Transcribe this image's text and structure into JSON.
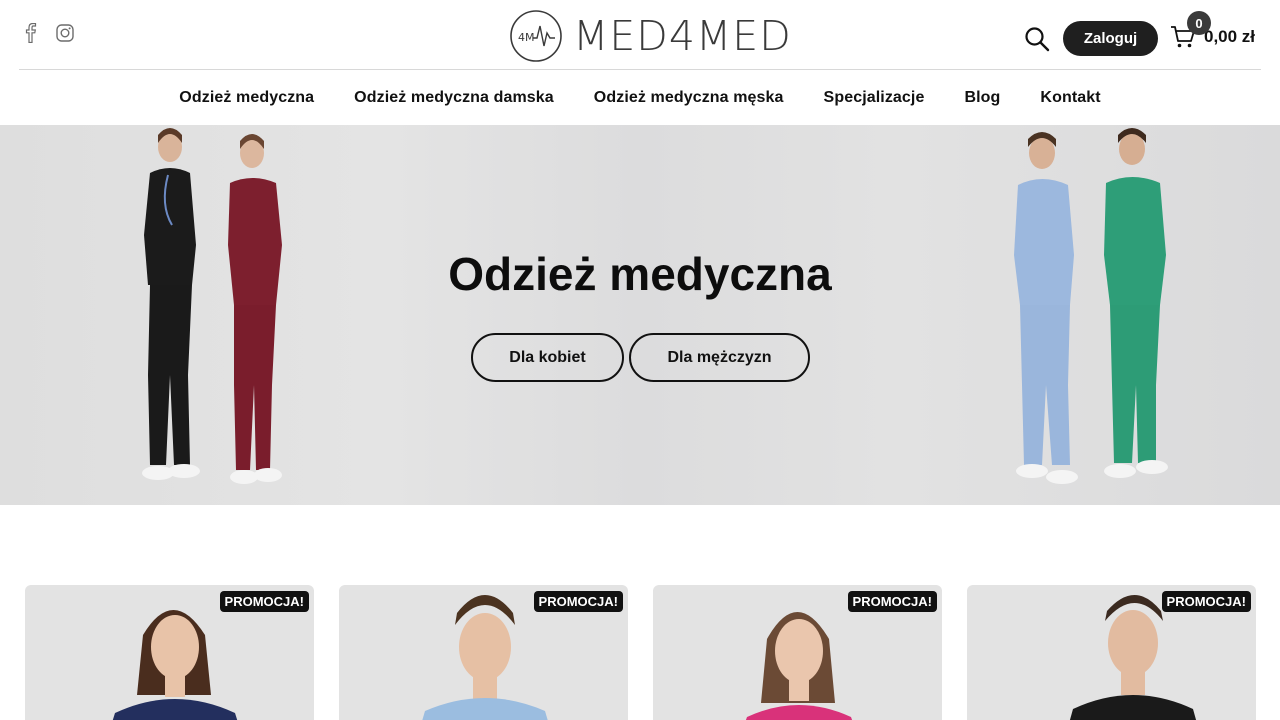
{
  "header": {
    "social": [
      {
        "icon": "facebook-icon"
      },
      {
        "icon": "instagram-icon"
      }
    ],
    "logo_mark": "4M",
    "logo_text": "MED4MED",
    "login_label": "Zaloguj",
    "cart_count": "0",
    "cart_total": "0,00 zł"
  },
  "nav": {
    "items": [
      {
        "label": "Odzież medyczna"
      },
      {
        "label": "Odzież medyczna damska"
      },
      {
        "label": "Odzież medyczna męska"
      },
      {
        "label": "Specjalizacje"
      },
      {
        "label": "Blog"
      },
      {
        "label": "Kontakt"
      }
    ]
  },
  "hero": {
    "title": "Odzież medyczna",
    "button_women": "Dla kobiet",
    "button_men": "Dla mężczyzn"
  },
  "products": [
    {
      "badge": "PROMOCJA!",
      "scrub_color": "#232f5e",
      "skin": "#e8c3a8",
      "hair": "#4a2d1e"
    },
    {
      "badge": "PROMOCJA!",
      "scrub_color": "#9bbde0",
      "skin": "#e6c0a4",
      "hair": "#4b3320"
    },
    {
      "badge": "PROMOCJA!",
      "scrub_color": "#d9327a",
      "skin": "#eac6ad",
      "hair": "#6b4a35"
    },
    {
      "badge": "PROMOCJA!",
      "scrub_color": "#1a1a1a",
      "skin": "#e2bba0",
      "hair": "#3b2a20"
    }
  ],
  "colors": {
    "accent_dark": "#1f1f1f",
    "hero_bg": "#e0e0e0"
  }
}
